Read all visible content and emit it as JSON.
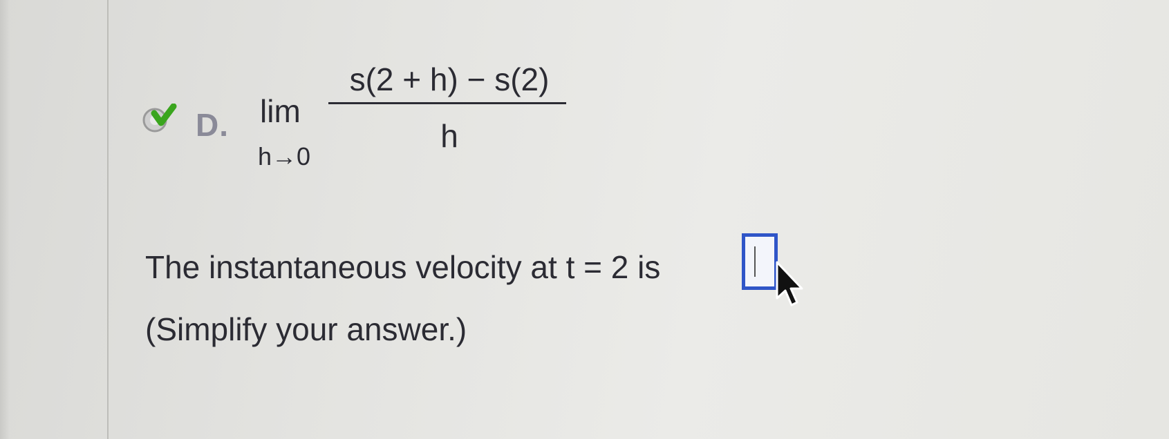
{
  "choice": {
    "letter": "D.",
    "lim_label": "lim",
    "lim_subscript": "h→0",
    "numerator": "s(2 + h) − s(2)",
    "denominator": "h",
    "selected": true,
    "check_icon": "green-check-icon"
  },
  "question": {
    "text": "The instantaneous velocity at t = 2 is",
    "answer_value": "",
    "hint": "(Simplify your answer.)"
  },
  "colors": {
    "check": "#3aa51e",
    "answer_border": "#2f55c8",
    "text": "#2b2b33"
  },
  "cursor_icon": "mouse-pointer-icon"
}
